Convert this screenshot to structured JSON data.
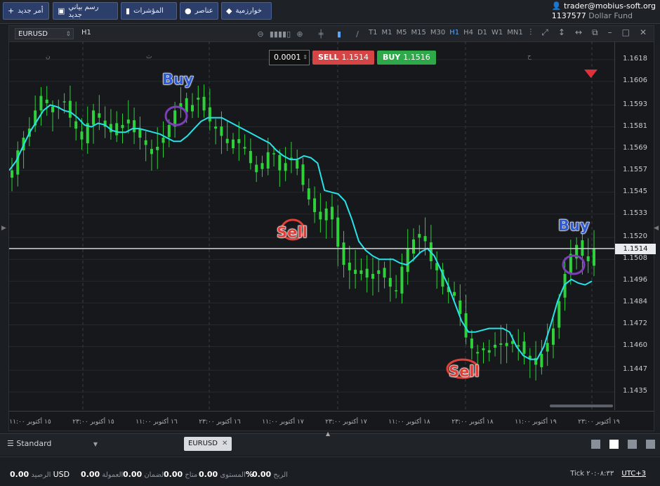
{
  "toolbar": {
    "buttons": [
      {
        "label": "أمر جديد",
        "icon": "plus-icon"
      },
      {
        "label": "رسم بياني جديد",
        "icon": "chart-icon"
      },
      {
        "label": "المؤشرات",
        "icon": "bars-icon"
      },
      {
        "label": "عناصر",
        "icon": "shapes-icon"
      },
      {
        "label": "خوارزمية",
        "icon": "diamond-icon"
      }
    ]
  },
  "account": {
    "user": "trader@mobius-soft.org",
    "number": "1137577",
    "fund": "Dollar Fund"
  },
  "chart_toolbar": {
    "symbol": "EURUSD",
    "timeframe_current": "H1",
    "timeframes": [
      "T1",
      "M1",
      "M5",
      "M15",
      "M30",
      "H1",
      "H4",
      "D1",
      "W1",
      "MN1"
    ],
    "active_timeframe": "H1"
  },
  "trade_panel": {
    "lot": "0.0001",
    "sell_label": "SELL",
    "sell_price": "1.1514",
    "buy_label": "BUY",
    "buy_price": "1.1516"
  },
  "chart_data": {
    "type": "candlestick",
    "symbol": "EURUSD",
    "timeframe": "H1",
    "y_ticks": [
      "1.1618",
      "1.1606",
      "1.1593",
      "1.1581",
      "1.1569",
      "1.1557",
      "1.1545",
      "1.1533",
      "1.1520",
      "1.1508",
      "1.1496",
      "1.1484",
      "1.1472",
      "1.1460",
      "1.1447",
      "1.1435"
    ],
    "ylim": [
      1.1425,
      1.1628
    ],
    "current_price": "1.1514",
    "x_ticks": [
      "١٥ أكتوبر ١١:٠٠",
      "١٥ أكتوبر ٢٣:٠٠",
      "١٦ أكتوبر ١١:٠٠",
      "١٦ أكتوبر ٢٣:٠٠",
      "١٧ أكتوبر ١١:٠٠",
      "١٧ أكتوبر ٢٣:٠٠",
      "١٨ أكتوبر ١١:٠٠",
      "١٨ أكتوبر ٢٣:٠٠",
      "١٩ أكتوبر ١١:٠٠",
      "١٩ أكتوبر ٢٣:٠٠"
    ],
    "day_markers": [
      "ن",
      "ث",
      "ح"
    ],
    "closes": [
      1.1557,
      1.1568,
      1.1575,
      1.158,
      1.159,
      1.1598,
      1.1594,
      1.1589,
      1.1592,
      1.1595,
      1.1586,
      1.158,
      1.1574,
      1.1583,
      1.159,
      1.1586,
      1.1581,
      1.1578,
      1.1583,
      1.1582,
      1.1585,
      1.1578,
      1.1575,
      1.1571,
      1.1566,
      1.157,
      1.1575,
      1.1582,
      1.159,
      1.1594,
      1.1589,
      1.1593,
      1.1597,
      1.159,
      1.1584,
      1.158,
      1.1576,
      1.1572,
      1.1574,
      1.1572,
      1.1569,
      1.1561,
      1.1556,
      1.1561,
      1.1567,
      1.1566,
      1.1557,
      1.1561,
      1.1564,
      1.1558,
      1.1549,
      1.1541,
      1.1534,
      1.153,
      1.1536,
      1.153,
      1.1515,
      1.1505,
      1.1502,
      1.15,
      1.15,
      1.1498,
      1.15,
      1.1502,
      1.1498,
      1.1493,
      1.1491,
      1.1504,
      1.1514,
      1.1519,
      1.1522,
      1.1518,
      1.1507,
      1.1502,
      1.1493,
      1.149,
      1.1488,
      1.1478,
      1.1465,
      1.1459,
      1.1457,
      1.1458,
      1.1458,
      1.1461,
      1.1461,
      1.1462,
      1.1463,
      1.146,
      1.1456,
      1.1453,
      1.145,
      1.1456,
      1.1462,
      1.147,
      1.1485,
      1.15,
      1.1511,
      1.1516,
      1.151,
      1.1507,
      1.1514
    ],
    "ma_values": [
      1.1557,
      1.1562,
      1.157,
      1.1578,
      1.1584,
      1.159,
      1.1593,
      1.1592,
      1.159,
      1.1589,
      1.1586,
      1.1582,
      1.1581,
      1.1583,
      1.1582,
      1.1579,
      1.1578,
      1.1578,
      1.158,
      1.158,
      1.1579,
      1.1578,
      1.1577,
      1.1575,
      1.1573,
      1.1573,
      1.1576,
      1.158,
      1.1584,
      1.1586,
      1.1586,
      1.1586,
      1.1584,
      1.1582,
      1.158,
      1.1578,
      1.1576,
      1.1574,
      1.1572,
      1.1568,
      1.1565,
      1.1563,
      1.1563,
      1.1565,
      1.1564,
      1.1561,
      1.1546,
      1.1545,
      1.1544,
      1.154,
      1.153,
      1.1518,
      1.1513,
      1.151,
      1.1508,
      1.1508,
      1.1508,
      1.1506,
      1.1505,
      1.1508,
      1.1512,
      1.1514,
      1.151,
      1.1502,
      1.1494,
      1.1484,
      1.1474,
      1.1468,
      1.1468,
      1.1469,
      1.147,
      1.147,
      1.147,
      1.1468,
      1.146,
      1.1455,
      1.1453,
      1.1453,
      1.146,
      1.1472,
      1.1485,
      1.1494,
      1.1497,
      1.1495,
      1.1494,
      1.1496
    ],
    "annotations": [
      {
        "label": "Buy",
        "type": "buy"
      },
      {
        "label": "Sell",
        "type": "sell"
      },
      {
        "label": "Sell",
        "type": "sell"
      },
      {
        "label": "Buy",
        "type": "buy"
      }
    ],
    "sell_signal_marker": "down-triangle"
  },
  "bottom": {
    "layout_name": "Standard",
    "tab": "EURUSD"
  },
  "status": {
    "balance": "0.00",
    "balance_label": "الرصيد",
    "currency": "USD",
    "commission": "0.00",
    "commission_label": "العمولة",
    "equity": "0.00",
    "equity_label": "الضمان",
    "margin": "0.00",
    "margin_label": "متاح",
    "level": "0.00",
    "level_label": "المستوى",
    "level_unit": "%",
    "profit": "0.00",
    "profit_label": "الربح",
    "tick_label": "Tick",
    "time": "٢٠:٠٨:٣٣",
    "utc": "UTC+3"
  }
}
